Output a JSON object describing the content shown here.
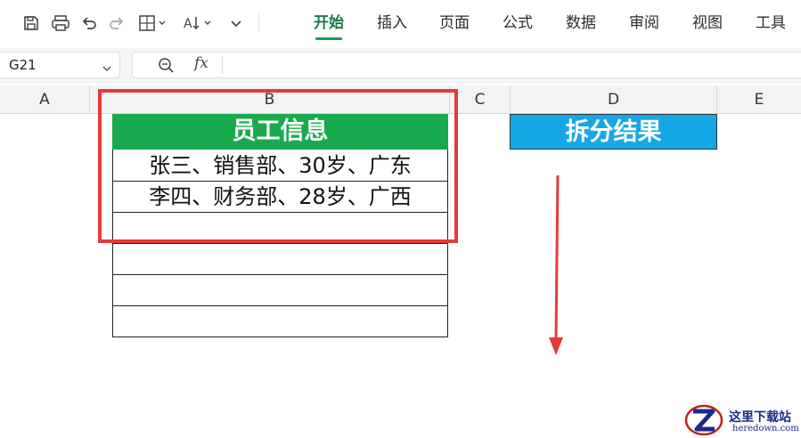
{
  "toolbar": {
    "tabs": [
      {
        "label": "开始",
        "active": true
      },
      {
        "label": "插入"
      },
      {
        "label": "页面"
      },
      {
        "label": "公式"
      },
      {
        "label": "数据"
      },
      {
        "label": "审阅"
      },
      {
        "label": "视图"
      },
      {
        "label": "工具"
      }
    ],
    "icons": [
      "save-icon",
      "print-icon",
      "undo-icon",
      "redo-icon",
      "borders-icon",
      "sort-icon",
      "more-chevron-icon"
    ],
    "active_tab_color": "#1a7a4a"
  },
  "formula_bar": {
    "cell_ref": "G21",
    "fx_label": "fx",
    "content": ""
  },
  "columns": [
    "A",
    "B",
    "C",
    "D",
    "E"
  ],
  "sheet": {
    "b_header": "员工信息",
    "b_rows": [
      "张三、销售部、30岁、广东",
      "李四、财务部、28岁、广西",
      "",
      "",
      "",
      ""
    ],
    "d_header": "拆分结果",
    "header_colors": {
      "green": "#1aaa4e",
      "blue": "#16a8e6"
    }
  },
  "annotations": {
    "highlight_color": "#e53a3a"
  },
  "watermark": {
    "title": "这里下载站",
    "url": "heredown.com"
  }
}
